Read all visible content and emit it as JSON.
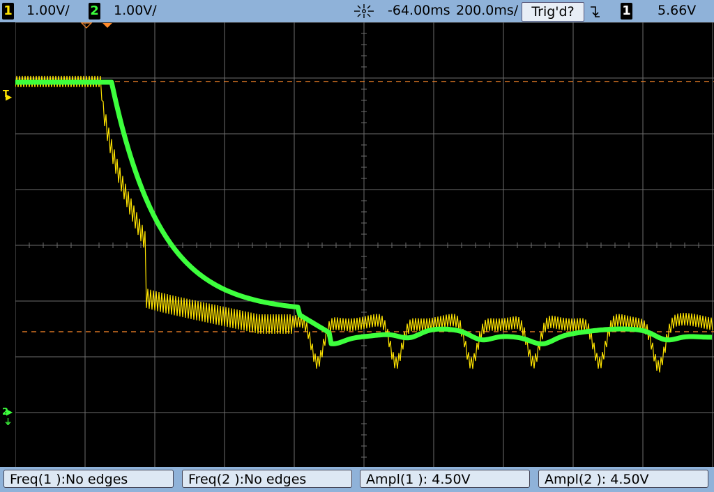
{
  "topbar": {
    "ch1_number": "1",
    "ch1_scale": "1.00V/",
    "ch2_number": "2",
    "ch2_scale": "1.00V/",
    "time_delay": "-64.00ms",
    "time_scale": "200.0ms/",
    "trigger_status": "Trig'd?",
    "trigger_slope_icon": "falling-edge-icon",
    "trigger_source": "1",
    "trigger_level": "5.66V"
  },
  "markers": {
    "trigger_level_label": "T",
    "ground_label": "2"
  },
  "measurements": [
    {
      "label": "Freq(1 ):No edges"
    },
    {
      "label": "Freq(2 ):No edges"
    },
    {
      "label": "Ampl(1 ): 4.50V"
    },
    {
      "label": "Ampl(2 ): 4.50V"
    }
  ],
  "colors": {
    "ch1": "#ffe400",
    "ch2": "#3dff3d",
    "bar": "#8fb2d9",
    "cursor": "#ff8a2a",
    "grid": "#6e6e6e"
  }
}
